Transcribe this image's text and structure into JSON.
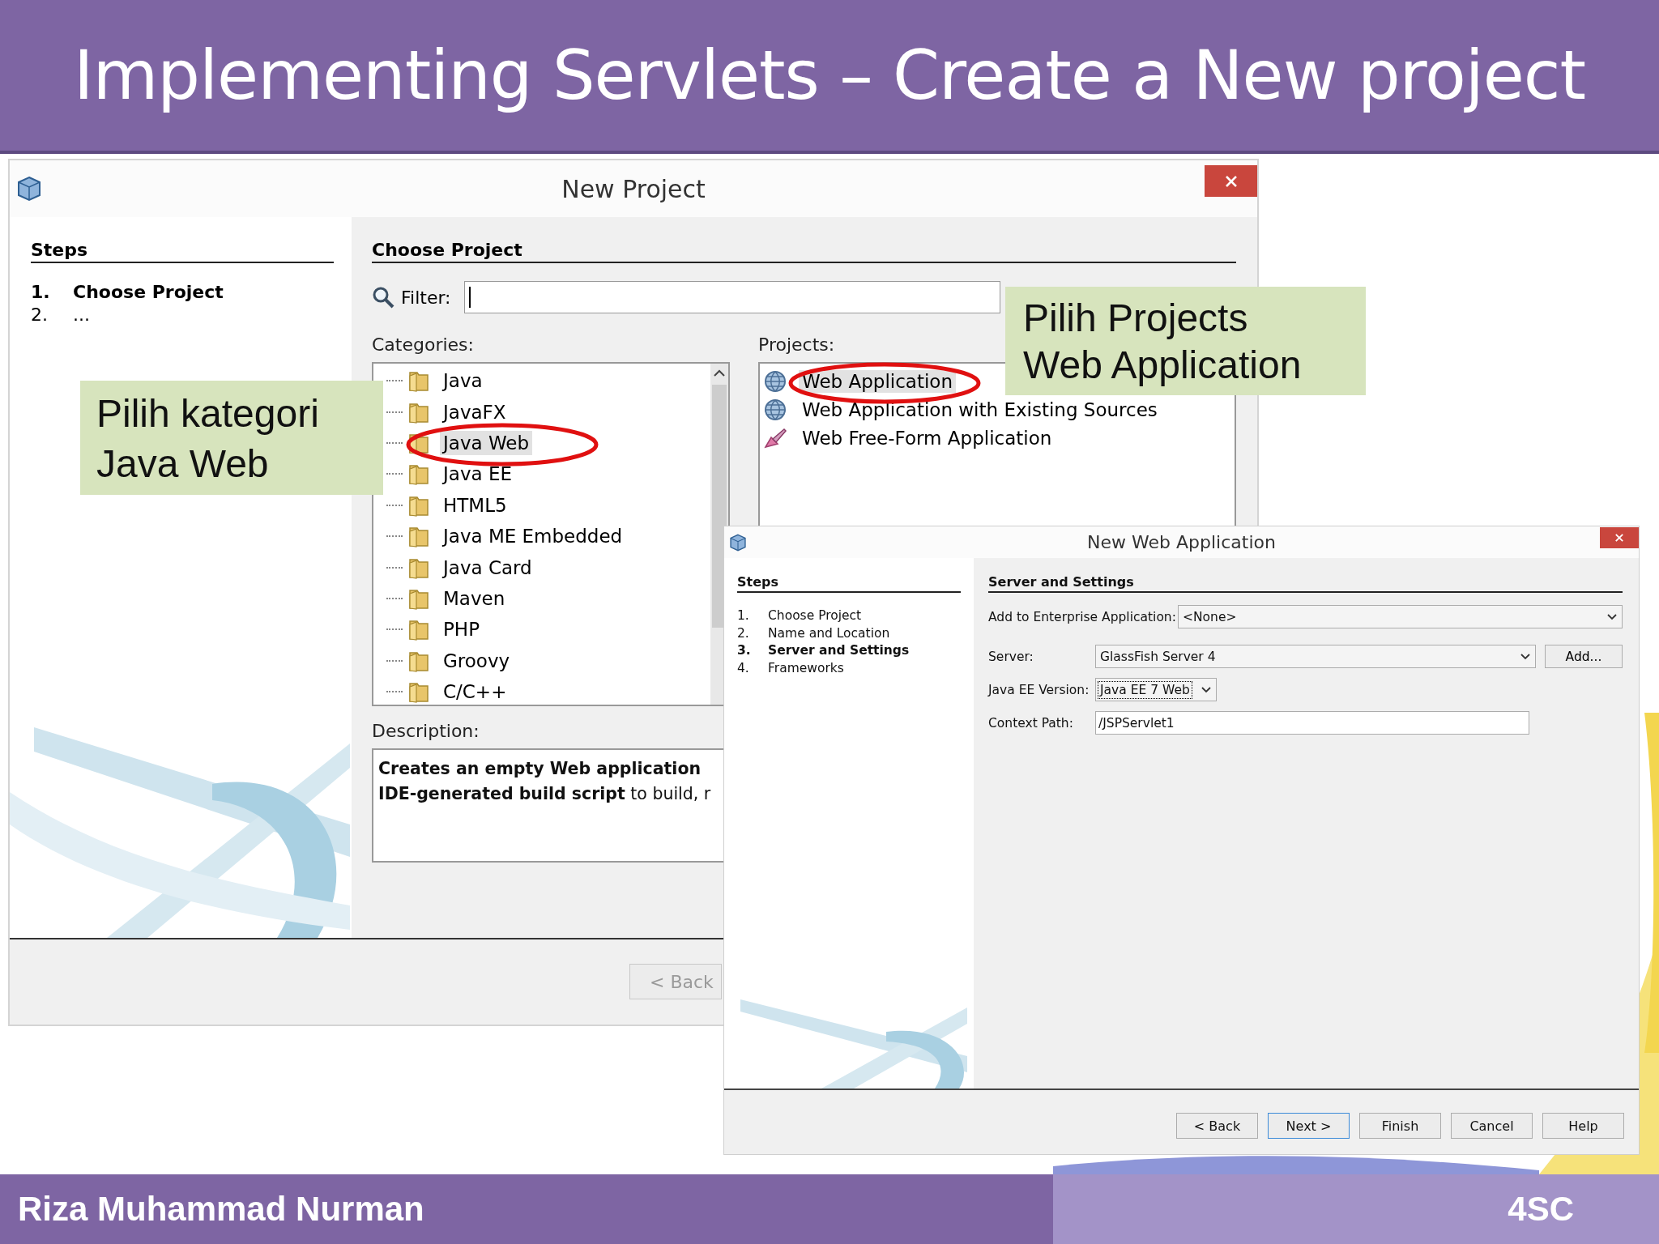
{
  "slide_title": "Implementing Servlets – Create a New project",
  "new_project_dialog": {
    "title": "New Project",
    "steps_heading": "Steps",
    "steps": [
      {
        "number": "1.",
        "label": "Choose Project",
        "selected": true
      },
      {
        "number": "2.",
        "label": "...",
        "selected": false
      }
    ],
    "panel_heading": "Choose Project",
    "filter_label": "Filter:",
    "categories_label": "Categories:",
    "categories": [
      {
        "label": "Java",
        "selected": false
      },
      {
        "label": "JavaFX",
        "selected": false
      },
      {
        "label": "Java Web",
        "selected": true
      },
      {
        "label": "Java EE",
        "selected": false
      },
      {
        "label": "HTML5",
        "selected": false
      },
      {
        "label": "Java ME Embedded",
        "selected": false
      },
      {
        "label": "Java Card",
        "selected": false
      },
      {
        "label": "Maven",
        "selected": false
      },
      {
        "label": "PHP",
        "selected": false
      },
      {
        "label": "Groovy",
        "selected": false
      },
      {
        "label": "C/C++",
        "selected": false
      }
    ],
    "projects_label": "Projects:",
    "projects": [
      {
        "label": "Web Application",
        "kind": "globe",
        "selected": true
      },
      {
        "label": "Web Application with Existing Sources",
        "kind": "globe",
        "selected": false
      },
      {
        "label": "Web Free-Form Application",
        "kind": "brush",
        "selected": false
      }
    ],
    "description_label": "Description:",
    "description_lines": [
      "**Creates an empty Web application**",
      "**IDE-generated build script** to build, r"
    ],
    "buttons": [
      {
        "label": "< Back",
        "disabled": true
      }
    ]
  },
  "new_web_application_dialog": {
    "title": "New Web Application",
    "steps_heading": "Steps",
    "steps": [
      {
        "number": "1.",
        "label": "Choose Project",
        "selected": false
      },
      {
        "number": "2.",
        "label": "Name and Location",
        "selected": false
      },
      {
        "number": "3.",
        "label": "Server and Settings",
        "selected": true
      },
      {
        "number": "4.",
        "label": "Frameworks",
        "selected": false
      }
    ],
    "panel_heading": "Server and Settings",
    "fields": [
      {
        "kind": "combo",
        "label": "Add to Enterprise Application:",
        "value": "<None>"
      },
      {
        "kind": "combo_button",
        "label": "Server:",
        "value": "GlassFish Server 4",
        "button": "Add..."
      },
      {
        "kind": "small_combo",
        "label": "Java EE Version:",
        "value": "Java EE 7 Web"
      },
      {
        "kind": "text",
        "label": "Context Path:",
        "value": "/JSPServlet1"
      }
    ],
    "buttons": [
      {
        "label": "< Back",
        "focused": false
      },
      {
        "label": "Next >",
        "focused": true
      },
      {
        "label": "Finish",
        "focused": false
      },
      {
        "label": "Cancel",
        "focused": false
      },
      {
        "label": "Help",
        "focused": false
      }
    ]
  },
  "callouts": [
    {
      "text": "Pilih kategori Java Web"
    },
    {
      "text": "Pilih Projects Web Application"
    }
  ],
  "footer": {
    "author": "Riza Muhammad Nurman",
    "code": "4SC"
  }
}
